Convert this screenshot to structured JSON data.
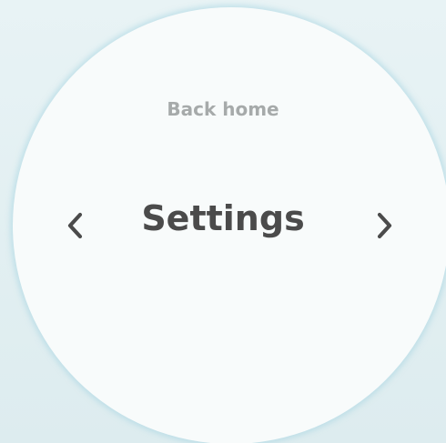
{
  "screen": {
    "back_link_label": "Back home",
    "title": "Settings"
  },
  "navigation": {
    "prev_icon": "chevron-left-icon",
    "next_icon": "chevron-right-icon"
  },
  "colors": {
    "background": "#e3f0f3",
    "face": "#f8fbfb",
    "face_glow": "#a8d6e2",
    "title_text": "#4b4b4b",
    "link_text": "#a6aaaa"
  }
}
